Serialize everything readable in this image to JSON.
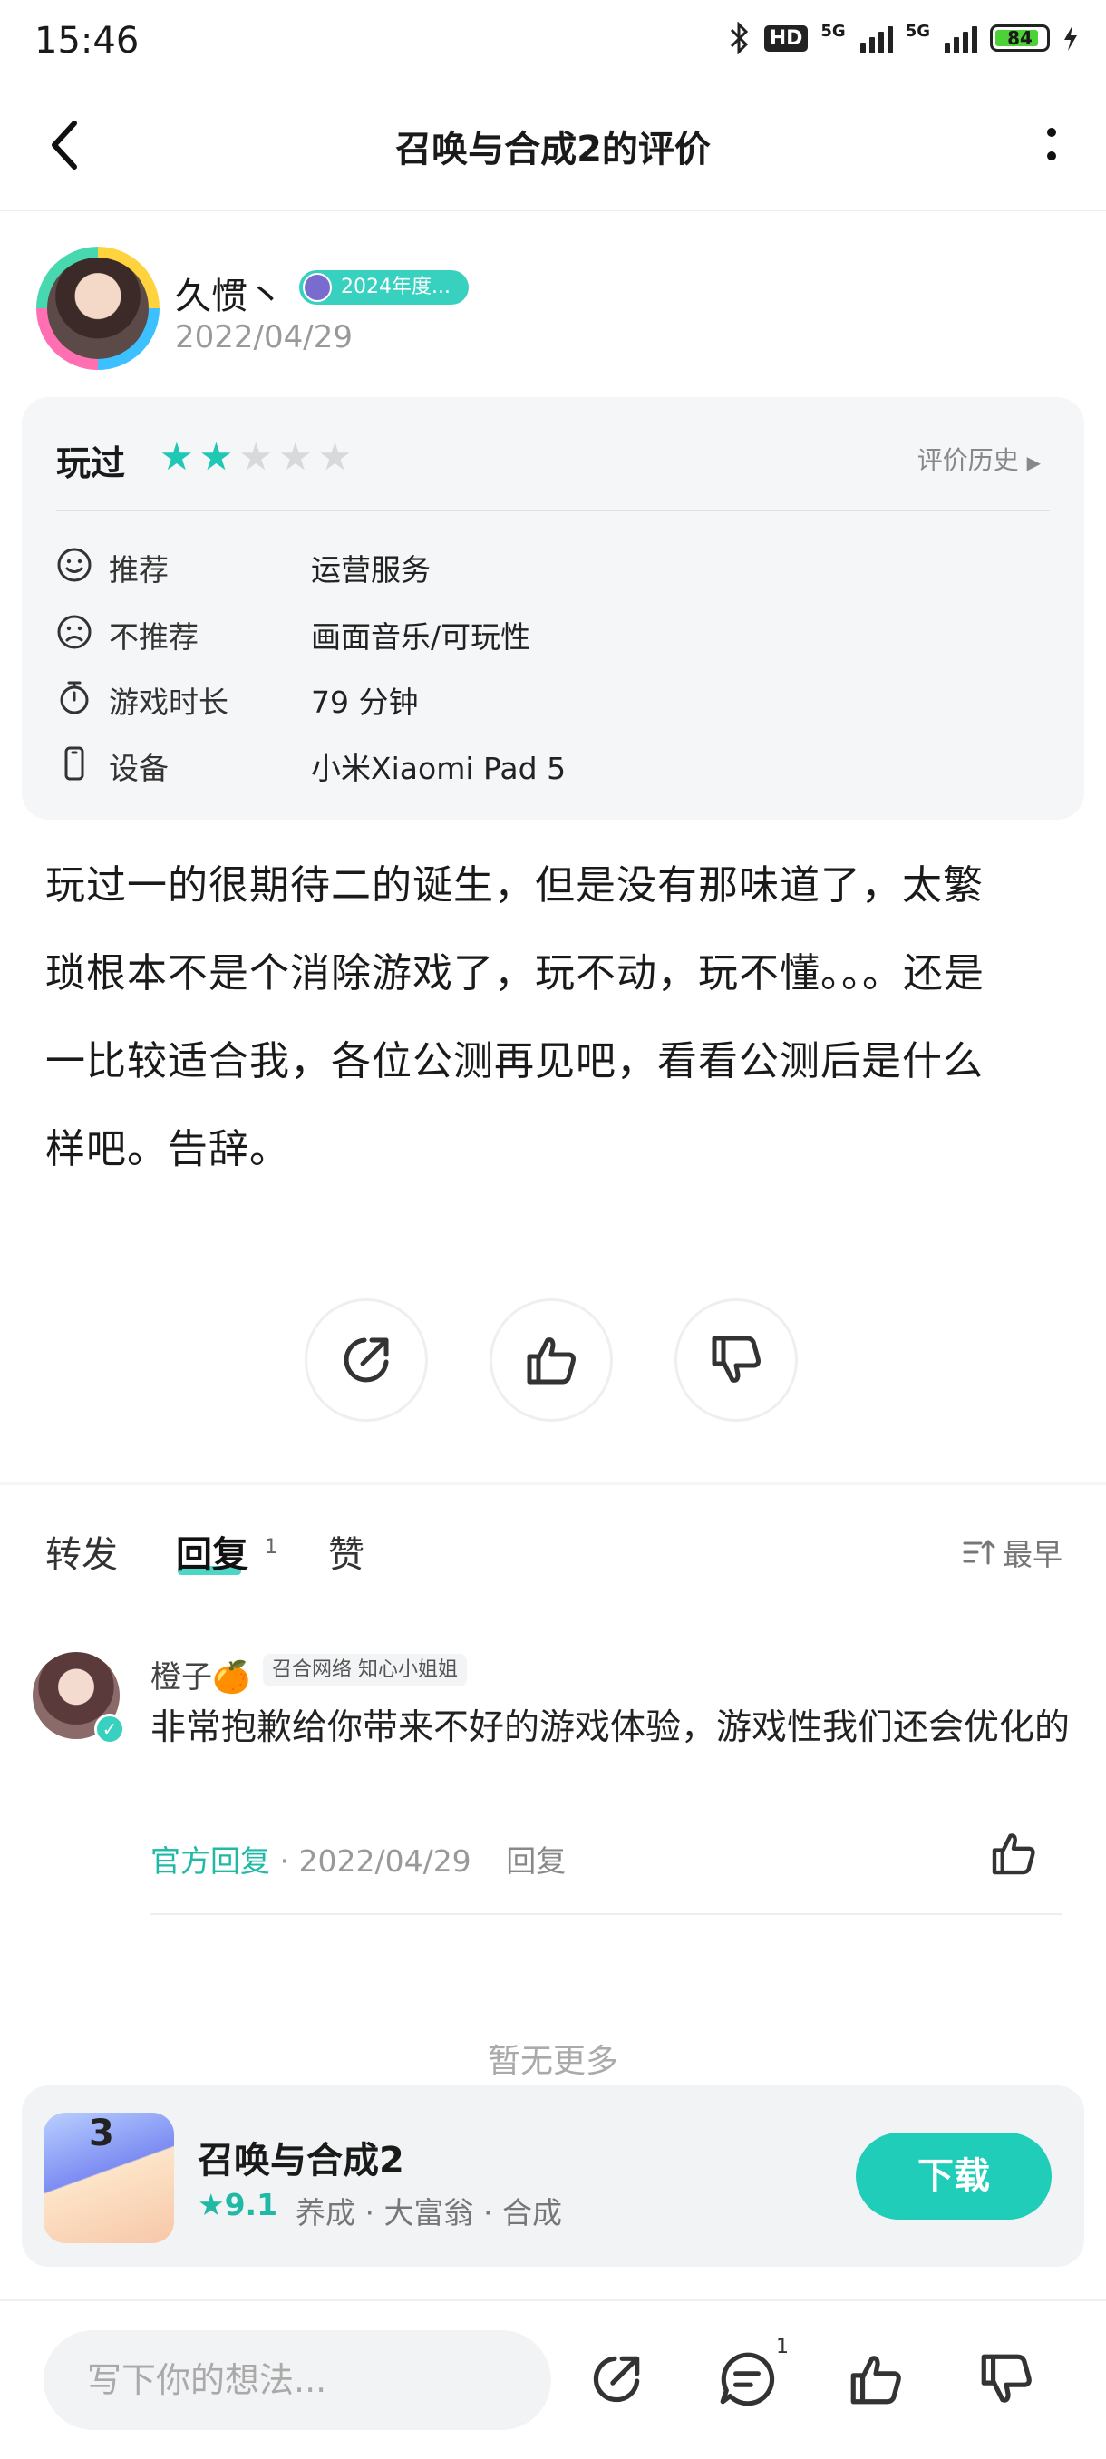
{
  "status_bar": {
    "time": "15:46",
    "battery": "84",
    "hd": "HD",
    "net1": "5G",
    "net2": "5G"
  },
  "header": {
    "title": "召唤与合成2的评价"
  },
  "author": {
    "name": "久惯丶",
    "badge": "2024年度...",
    "date": "2022/04/29"
  },
  "review_card": {
    "played_label": "玩过",
    "stars_filled": 2,
    "stars_total": 5,
    "history_label": "评价历史",
    "rows": [
      {
        "icon": "smile-icon",
        "label": "推荐",
        "value": "运营服务"
      },
      {
        "icon": "frown-icon",
        "label": "不推荐",
        "value": "画面音乐/可玩性"
      },
      {
        "icon": "stopwatch-icon",
        "label": "游戏时长",
        "value": "79 分钟"
      },
      {
        "icon": "phone-icon",
        "label": "设备",
        "value": "小米Xiaomi Pad 5"
      }
    ]
  },
  "body": {
    "lines": [
      "玩过一的很期待二的诞生，但是没有那味道了，太繁",
      "琐根本不是个消除游戏了，玩不动，玩不懂。。。还是",
      "一比较适合我，各位公测再见吧，看看公测后是什么",
      "样吧。告辞。"
    ]
  },
  "tabs": {
    "forward": "转发",
    "reply": "回复",
    "reply_count": "1",
    "like": "赞",
    "sort": "最早"
  },
  "reply": {
    "name": "橙子🍊",
    "tag": "召合网络 知心小姐姐",
    "text": "非常抱歉给你带来不好的游戏体验，游戏性我们还会优化的",
    "official": "官方回复",
    "date": "· 2022/04/29",
    "reply_action": "回复"
  },
  "no_more": "暂无更多",
  "app": {
    "name": "召唤与合成2",
    "rating": "9.1",
    "tags": "养成 · 大富翁 · 合成",
    "icon_number": "3",
    "download": "下载"
  },
  "bottom": {
    "placeholder": "写下你的想法...",
    "reply_count": "1"
  },
  "colors": {
    "accent": "#1fcdb8",
    "star_on": "#1fc7b5",
    "star_off": "#d7d9db"
  }
}
